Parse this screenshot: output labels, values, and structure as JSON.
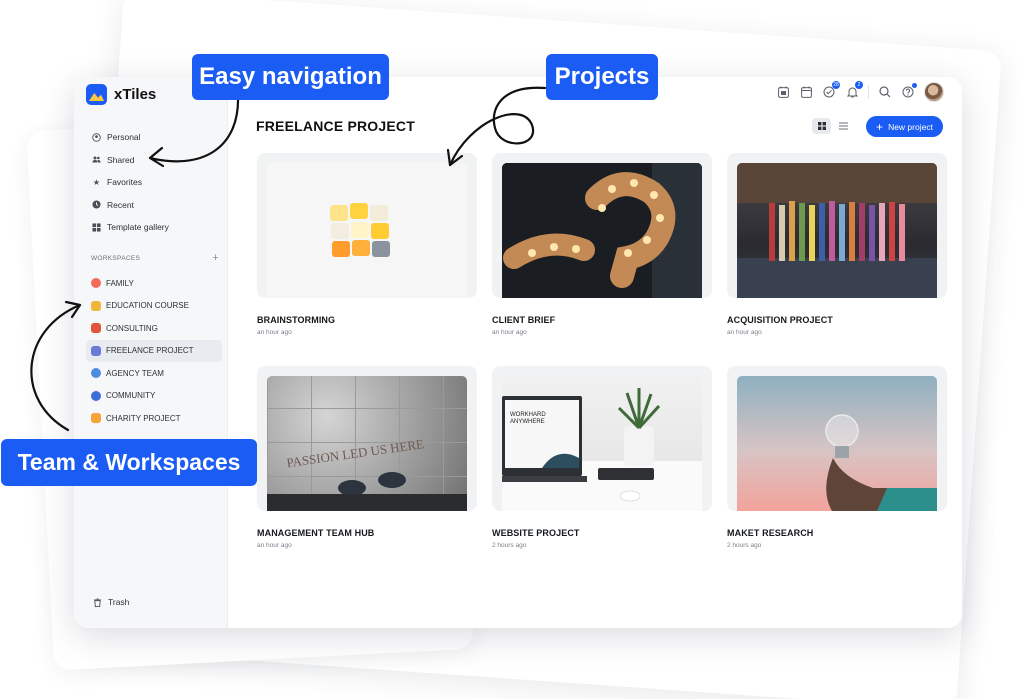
{
  "app": {
    "name": "xTiles"
  },
  "sidebar": {
    "nav": [
      {
        "label": "Personal",
        "icon": "user-circle-icon"
      },
      {
        "label": "Shared",
        "icon": "users-icon"
      },
      {
        "label": "Favorites",
        "icon": "star-icon"
      },
      {
        "label": "Recent",
        "icon": "clock-icon"
      },
      {
        "label": "Template gallery",
        "icon": "grid-icon"
      }
    ],
    "workspaces_heading": "WORKSPACES",
    "workspaces": [
      {
        "label": "FAMILY",
        "color": "#f26b5b"
      },
      {
        "label": "EDUCATION COURSE",
        "color": "#f0b73c"
      },
      {
        "label": "CONSULTING",
        "color": "#e0563c"
      },
      {
        "label": "FREELANCE PROJECT",
        "color": "#6a7bd9",
        "active": true
      },
      {
        "label": "AGENCY TEAM",
        "color": "#4c8de0"
      },
      {
        "label": "COMMUNITY",
        "color": "#3d6ed8"
      },
      {
        "label": "CHARITY PROJECT",
        "color": "#f4a23a"
      }
    ],
    "trash_label": "Trash"
  },
  "topbar": {
    "badges": {
      "tasks": "28",
      "notifications": "2"
    }
  },
  "main": {
    "title": "FREELANCE PROJECT",
    "new_button": "New project",
    "projects": [
      {
        "name": "BRAINSTORMING",
        "time": "an hour ago"
      },
      {
        "name": "CLIENT BRIEF",
        "time": "an hour ago"
      },
      {
        "name": "ACQUISITION PROJECT",
        "time": "an hour ago"
      },
      {
        "name": "MANAGEMENT TEAM HUB",
        "time": "an hour ago"
      },
      {
        "name": "WEBSITE PROJECT",
        "time": "2 hours ago"
      },
      {
        "name": "MAKET RESEARCH",
        "time": "2 hours ago"
      }
    ]
  },
  "image_text": {
    "floor": "PASSION LED US HERE",
    "laptop_line1": "WORKHARD",
    "laptop_line2": "ANYWHERE"
  },
  "callouts": {
    "navigation": "Easy navigation",
    "projects": "Projects",
    "team": "Team & Workspaces"
  },
  "colors": {
    "accent": "#1b5cf4"
  }
}
